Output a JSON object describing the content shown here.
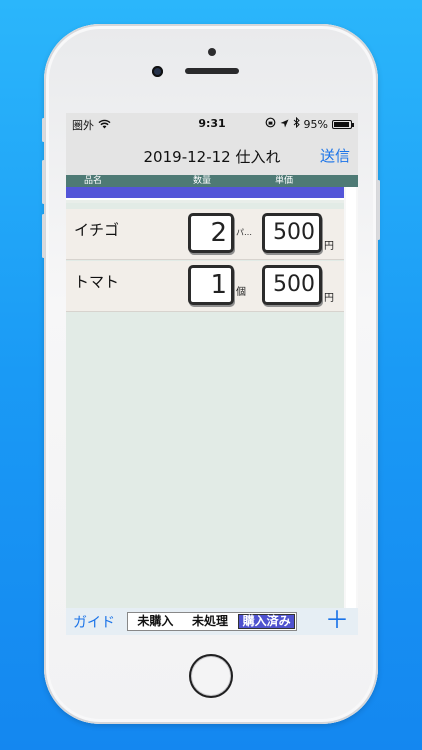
{
  "status_bar": {
    "carrier": "圏外",
    "time": "9:31",
    "battery_text": "95%",
    "battery_level": 0.95
  },
  "nav": {
    "title": "2019-12-12 仕入れ",
    "send_label": "送信"
  },
  "columns": {
    "name": "品名",
    "quantity": "数量",
    "unit_price": "単価"
  },
  "items": [
    {
      "name": "イチゴ",
      "quantity": "2",
      "unit": "パ…",
      "price": "500",
      "currency": "円"
    },
    {
      "name": "トマト",
      "quantity": "1",
      "unit": "個",
      "price": "500",
      "currency": "円"
    }
  ],
  "toolbar": {
    "guide_label": "ガイド",
    "segments": [
      "未購入",
      "未処理",
      "購入済み"
    ],
    "selected_segment": "購入済み",
    "add_label": "＋"
  },
  "colors": {
    "accent": "#1a73e8",
    "header_bar": "#4e7a75",
    "blue_strip": "#5355d8",
    "segment_active": "#4f52cf"
  }
}
